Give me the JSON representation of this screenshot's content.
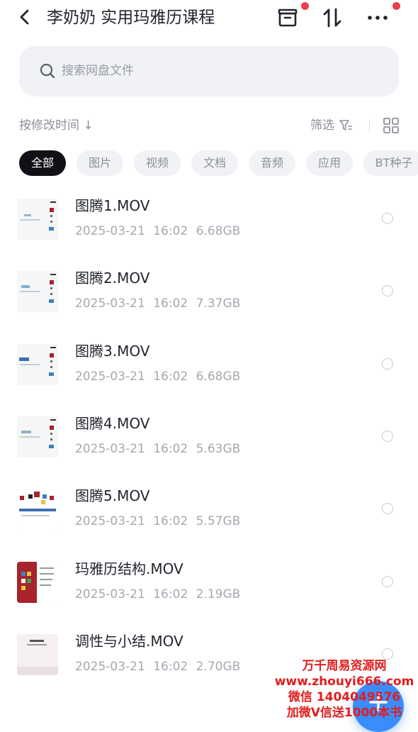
{
  "header": {
    "title": "李奶奶 实用玛雅历课程",
    "back_icon": "chevron-left-icon",
    "actions": [
      "archive-box-icon",
      "sort-arrows-icon",
      "more-dots-icon"
    ],
    "badge_color": "#ee3e4e"
  },
  "search": {
    "placeholder": "搜索网盘文件",
    "value": ""
  },
  "sort": {
    "label": "按修改时间 ↓",
    "filter_label": "筛选"
  },
  "chips": [
    {
      "label": "全部",
      "active": true
    },
    {
      "label": "图片",
      "active": false
    },
    {
      "label": "视频",
      "active": false
    },
    {
      "label": "文档",
      "active": false
    },
    {
      "label": "音频",
      "active": false
    },
    {
      "label": "应用",
      "active": false
    },
    {
      "label": "BT种子",
      "active": false
    }
  ],
  "files": [
    {
      "name": "图腾1.MOV",
      "date": "2025-03-21",
      "time": "16:02",
      "size": "6.68GB"
    },
    {
      "name": "图腾2.MOV",
      "date": "2025-03-21",
      "time": "16:02",
      "size": "7.37GB"
    },
    {
      "name": "图腾3.MOV",
      "date": "2025-03-21",
      "time": "16:02",
      "size": "6.68GB"
    },
    {
      "name": "图腾4.MOV",
      "date": "2025-03-21",
      "time": "16:02",
      "size": "5.63GB"
    },
    {
      "name": "图腾5.MOV",
      "date": "2025-03-21",
      "time": "16:02",
      "size": "5.57GB"
    },
    {
      "name": "玛雅历结构.MOV",
      "date": "2025-03-21",
      "time": "16:02",
      "size": "2.19GB"
    },
    {
      "name": "调性与小结.MOV",
      "date": "2025-03-21",
      "time": "16:02",
      "size": "2.70GB"
    }
  ],
  "watermark": {
    "line1": "万千周易资源网",
    "line2": "www.zhouyi666.com",
    "line3": "微信 1404049576",
    "line4": "加微V信送1000本书",
    "color": "#e11d1d"
  },
  "fab": {
    "icon": "plus-icon",
    "color": "#3b8cff"
  }
}
